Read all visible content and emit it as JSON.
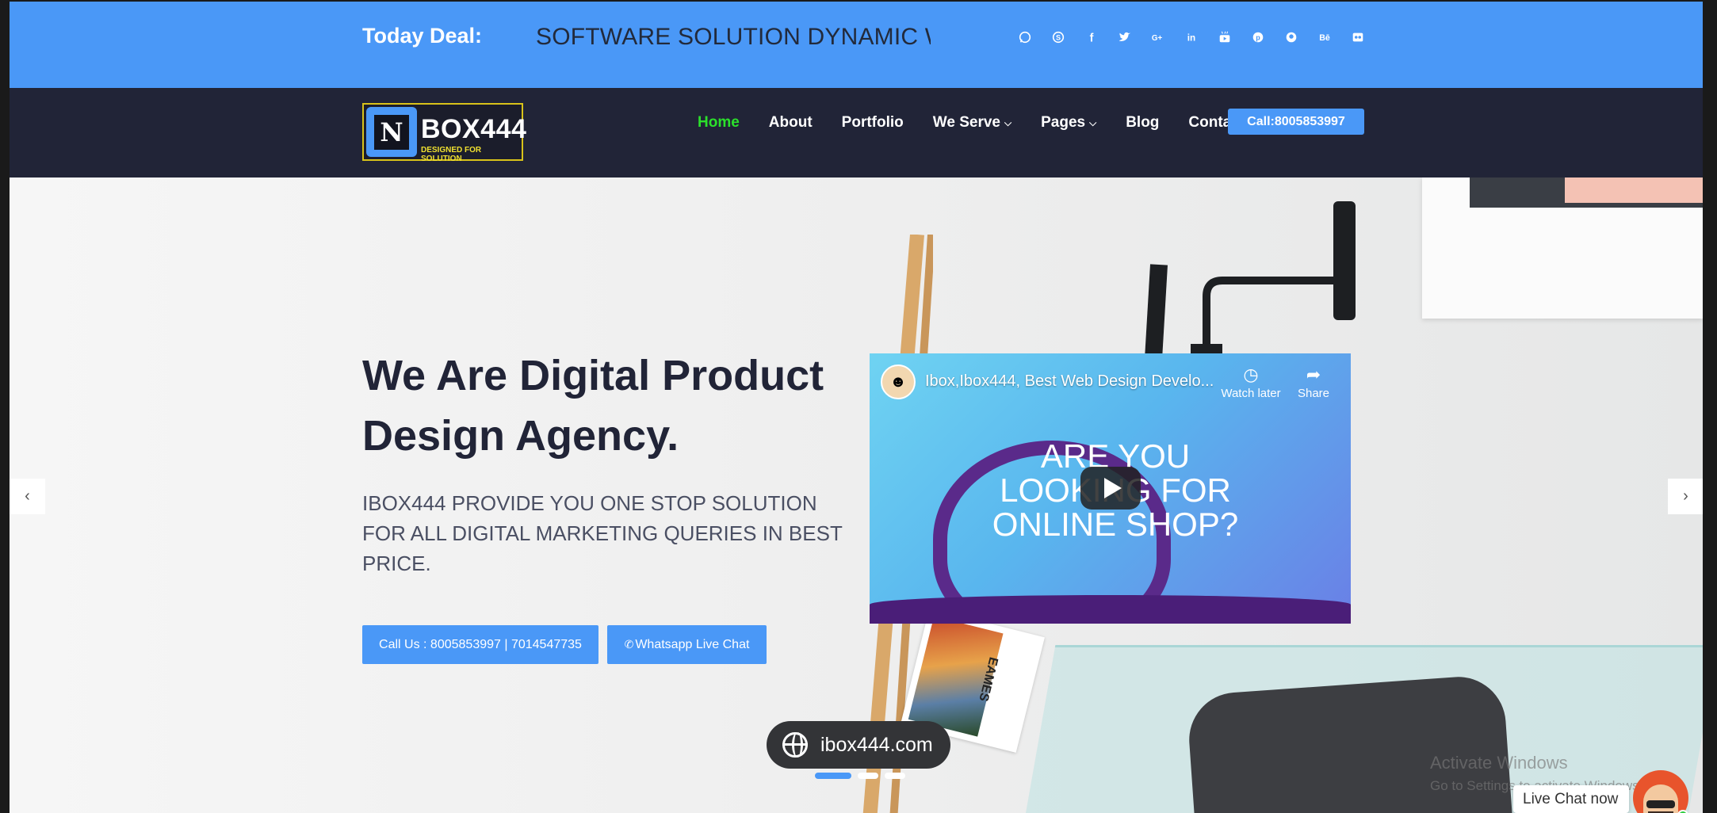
{
  "topbar": {
    "deal_label": "Today Deal:",
    "deal_text": "SOFTWARE SOLUTION DYNAMIC W",
    "social_icons": [
      "whatsapp-icon",
      "skype-icon",
      "facebook-icon",
      "twitter-icon",
      "google-plus-icon",
      "linkedin-icon",
      "youtube-icon",
      "pinterest-icon",
      "github-icon",
      "behance-icon",
      "flickr-icon"
    ],
    "colors": {
      "bar": "#4a98f7"
    }
  },
  "nav": {
    "logo_text": "BOX444",
    "logo_sub": "DESIGNED FOR SOLUTION",
    "menu": [
      {
        "label": "Home",
        "active": true
      },
      {
        "label": "About"
      },
      {
        "label": "Portfolio"
      },
      {
        "label": "We Serve",
        "dropdown": true
      },
      {
        "label": "Pages",
        "dropdown": true
      },
      {
        "label": "Blog"
      },
      {
        "label": "Contact"
      }
    ],
    "call_label": "Call:8005853997",
    "colors": {
      "bg": "#212437",
      "active": "#2be02b"
    }
  },
  "hero": {
    "title": "We Are Digital Product Design Agency.",
    "subtitle": "IBOX444 PROVIDE YOU ONE STOP SOLUTION FOR ALL DIGITAL MARKETING QUERIES IN BEST PRICE.",
    "call_button": "Call Us : 8005853997 | 7014547735",
    "whatsapp_button": "Whatsapp Live Chat",
    "magazine_label": "EAMES",
    "prev_arrow": "‹",
    "next_arrow": "›",
    "slide_count": 3,
    "active_slide": 1
  },
  "video": {
    "title": "Ibox,Ibox444, Best Web Design Develo...",
    "watch_later": "Watch later",
    "share": "Share",
    "thumbnail_text": "ARE YOU LOOKING FOR ONLINE SHOP?"
  },
  "overlay": {
    "domain": "ibox444.com",
    "activate_title": "Activate Windows",
    "activate_sub": "Go to Settings to activate Windows.",
    "live_chat": "Live Chat now"
  }
}
